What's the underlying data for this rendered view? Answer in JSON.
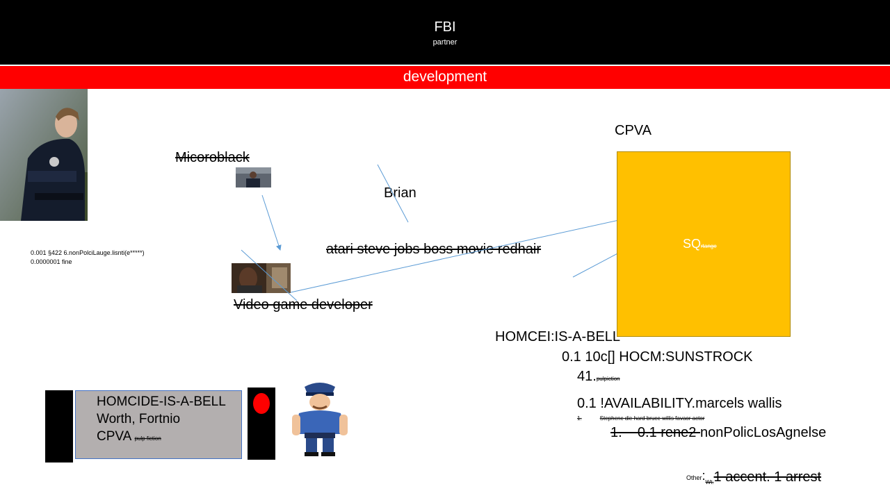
{
  "header": {
    "title": "FBI",
    "subtitle": "partner"
  },
  "banner": {
    "label": "development"
  },
  "labels": {
    "micoroblack": "Micoroblack",
    "brian": "Brian",
    "atari": "atari steve jobs boss movie redhair",
    "video_game_dev": "Video game developer",
    "cpva_top": "CPVA"
  },
  "notes": {
    "line1": "0.001 §422 6.nonPolciLauge.lisnti(e*****)",
    "line2": "0.0000001 fine"
  },
  "square": {
    "main": "SQ",
    "small": "rtange"
  },
  "list": {
    "l1": "HOMCEI:IS-A-BELL",
    "l2": "0.1 10c[] HOCM:SUNSTROCK",
    "l3_main": "41.",
    "l3_small": "pulpiction",
    "l4": "0.1 !AVAILABILITY.marcels wallis",
    "l5_num": "1.",
    "l5_text": "Stephenc die hard bruce willis favaor actor",
    "l6_struck": "1.    0.1 rene2 ",
    "l6_plain": "nonPolicLosAgnelse"
  },
  "other": {
    "label": "Other",
    "colon": ":",
    "wt": "Wt.",
    "struck": "1 accent. 1 arrest"
  },
  "graybox": {
    "line1": "HOMCIDE-IS-A-BELL",
    "line2": "Worth, Fortnio",
    "line3": "CPVA",
    "line3_small": "pulp fiction"
  },
  "colors": {
    "topbar": "#000000",
    "banner": "#ff0000",
    "square": "#ffc000",
    "arrow": "#5b9bd5",
    "graybox": "#b3afaf",
    "light": "#ff0000"
  }
}
